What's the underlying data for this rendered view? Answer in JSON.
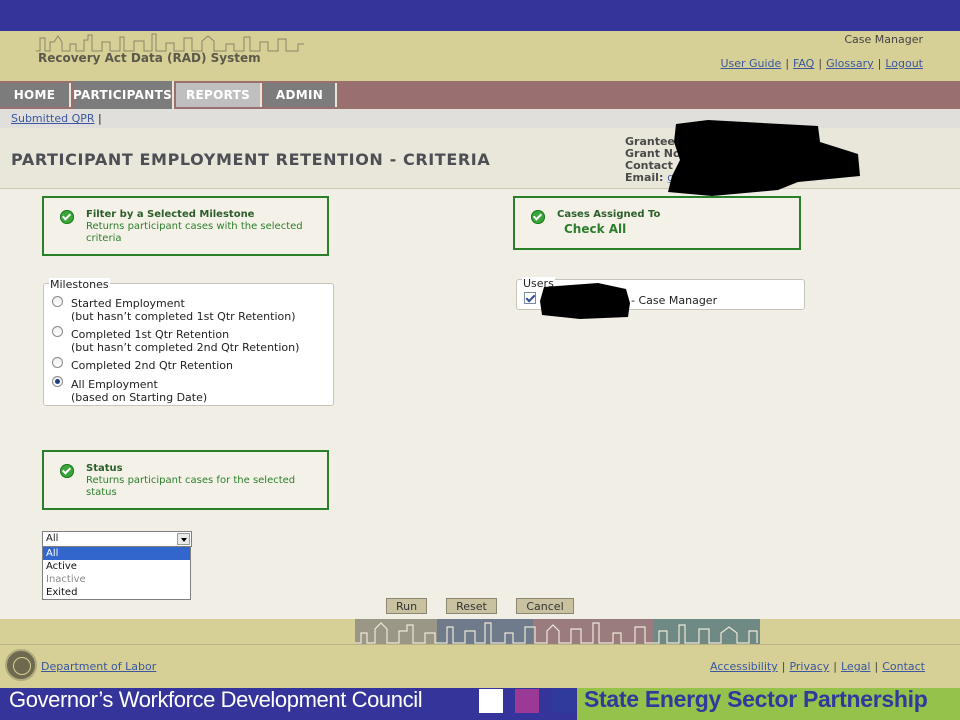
{
  "header": {
    "app_title": "Recovery Act Data (RAD) System",
    "user_role": "Case Manager",
    "links": [
      "User Guide",
      "FAQ",
      "Glossary",
      "Logout"
    ]
  },
  "nav": {
    "tabs": [
      {
        "label": "HOME"
      },
      {
        "label": "PARTICIPANTS"
      },
      {
        "label": "REPORTS"
      },
      {
        "label": "ADMIN"
      }
    ]
  },
  "breadcrumb": {
    "link": "Submitted QPR",
    "sep": "|"
  },
  "page": {
    "title": "PARTICIPANT EMPLOYMENT RETENTION - CRITERIA",
    "grantee": {
      "grantee_label": "Grantee",
      "grant_label": "Grant No",
      "contact_label": "Contact",
      "email_label": "Email:",
      "email_value": "g"
    }
  },
  "milestone_filter": {
    "title": "Filter by a Selected Milestone",
    "desc_line1": "Returns participant cases with the selected",
    "desc_line2": "criteria"
  },
  "cases_filter": {
    "title": "Cases Assigned To",
    "check_all": "Check All"
  },
  "milestones": {
    "legend": "Milestones",
    "options": [
      {
        "line1": "Started Employment",
        "line2": "(but hasn’t completed 1st Qtr Retention)"
      },
      {
        "line1": "Completed 1st Qtr Retention",
        "line2": "(but hasn’t completed 2nd Qtr Retention)"
      },
      {
        "line1": "Completed 2nd Qtr Retention",
        "line2": ""
      },
      {
        "line1": "All Employment",
        "line2": "(based on Starting Date)"
      }
    ],
    "selected": "All Employment"
  },
  "users": {
    "legend": "Users",
    "items": [
      {
        "label": "- Case Manager",
        "checked": true
      }
    ]
  },
  "status_filter": {
    "title": "Status",
    "desc_line1": "Returns participant cases for the selected",
    "desc_line2": "status"
  },
  "status_select": {
    "value": "All",
    "options": [
      "All",
      "Active",
      "Inactive",
      "Exited"
    ]
  },
  "buttons": {
    "run": "Run",
    "reset": "Reset",
    "cancel": "Cancel"
  },
  "footer": {
    "dol": "Department of Labor",
    "links": [
      "Accessibility",
      "Privacy",
      "Legal",
      "Contact"
    ]
  },
  "brand": {
    "left": "Governor’s Workforce Development Council",
    "right": "State Energy Sector Partnership",
    "colors": {
      "bar": "#34349a",
      "right_bg": "#94c24a",
      "sq1": "#ffffff",
      "sq2": "#9b3a96",
      "sq3": "#2e3a9c"
    }
  }
}
